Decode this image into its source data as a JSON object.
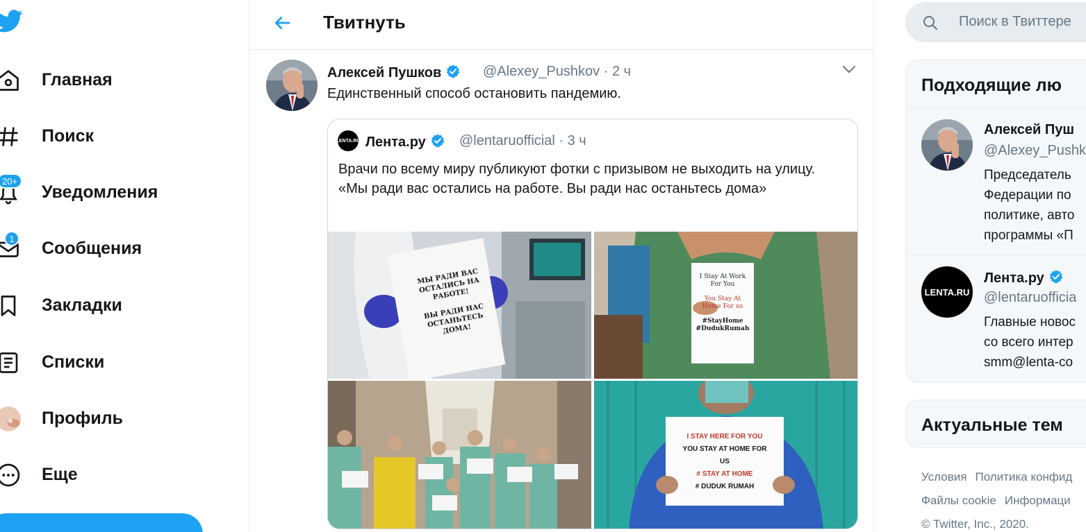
{
  "nav": {
    "items": [
      {
        "label": "Главная",
        "icon": "home-icon"
      },
      {
        "label": "Поиск",
        "icon": "hashtag-icon"
      },
      {
        "label": "Уведомления",
        "icon": "bell-icon",
        "badge": "20+"
      },
      {
        "label": "Сообщения",
        "icon": "envelope-icon",
        "badge": "1"
      },
      {
        "label": "Закладки",
        "icon": "bookmark-icon"
      },
      {
        "label": "Списки",
        "icon": "list-icon"
      },
      {
        "label": "Профиль",
        "icon": "avatar"
      },
      {
        "label": "Еще",
        "icon": "more-icon"
      }
    ]
  },
  "header": {
    "title": "Твитнуть"
  },
  "tweet": {
    "author_name": "Алексей Пушков",
    "handle": "@Alexey_Pushkov",
    "time": "· 2 ч",
    "text": "Единственный способ остановить пандемию.",
    "quote": {
      "avatar_text": "LENTA.RU",
      "name": "Лента.ру",
      "handle": "@lentaruofficial",
      "time": "· 3 ч",
      "text": "Врачи по всему миру публикуют фотки с призывом не выходить на улицу. «Мы ради вас остались на работе. Вы ради нас останьтесь дома»",
      "photos": [
        {
          "sign": [
            "МЫ РАДИ ВАС",
            "ОСТАЛИСЬ НА",
            "РАБОТЕ!",
            "",
            "ВЫ РАДИ НАС",
            "ОСТАНЬТЕСЬ",
            "ДОМА!"
          ]
        },
        {
          "sign": [
            "I Stay At Work",
            "For You",
            "",
            "You Stay At",
            "Home For us",
            "",
            "#StayHome",
            "#DudukRumah"
          ]
        },
        {
          "sign": []
        },
        {
          "sign": [
            "I STAY HERE FOR YOU",
            "YOU STAY AT HOME FOR",
            "US",
            "# STAY AT HOME",
            "# DUDUK RUMAH"
          ]
        }
      ]
    }
  },
  "search": {
    "placeholder": "Поиск в Твиттере"
  },
  "who_to_follow": {
    "title": "Подходящие лю",
    "items": [
      {
        "name": "Алексей Пуш",
        "handle": "@Alexey_Pushk",
        "bio": "Председатель\nФедерации по\nполитике, авто\nпрограммы «П"
      },
      {
        "name": "Лента.ру",
        "handle": "@lentaruofficia",
        "avatar_text": "LENTA.RU",
        "bio": "Главные новос\nсо всего интер\nsmm@lenta-co"
      }
    ]
  },
  "trends": {
    "title": "Актуальные тем"
  },
  "footer": {
    "line1": [
      "Условия",
      "Политика конфид"
    ],
    "line2": [
      "Файлы cookie",
      "Информаци"
    ],
    "line3": "© Twitter, Inc., 2020."
  },
  "colors": {
    "accent": "#1da1f2",
    "secondary_text": "#657786",
    "border": "#e6ecf0"
  }
}
